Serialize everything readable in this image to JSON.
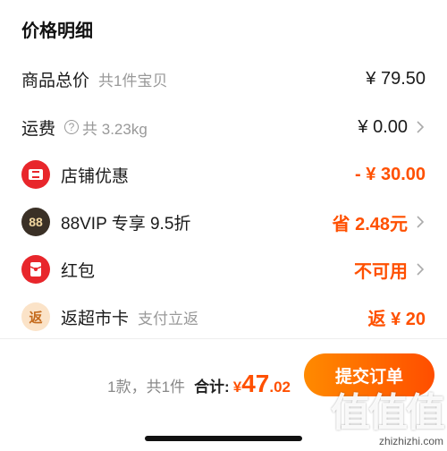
{
  "page": {
    "title": "价格明细"
  },
  "rows": [
    {
      "label": "商品总价",
      "sub": "共1件宝贝",
      "value": "¥ 79.50"
    },
    {
      "label": "运费",
      "sub": "共 3.23kg",
      "value": "¥ 0.00"
    },
    {
      "label": "店铺优惠",
      "value": "- ¥ 30.00"
    },
    {
      "label": "88VIP 专享 9.5折",
      "value": "省 2.48元",
      "icon_text": "88"
    },
    {
      "label": "红包",
      "value": "不可用"
    },
    {
      "label": "返超市卡",
      "sub": "支付立返",
      "value": "返 ¥ 20",
      "icon_text": "返"
    }
  ],
  "icons": {
    "help": "question-circle-icon",
    "shop_discount": "shop-coupon-icon",
    "vip": "88vip-badge-icon",
    "red_packet": "red-packet-icon",
    "supermarket": "supermarket-card-icon",
    "chevron": "chevron-right-icon"
  },
  "footer": {
    "count": "1款，共1件",
    "total_label": "合计:",
    "currency": "¥",
    "total_int": "47",
    "total_dec": ".02",
    "submit_label": "提交订单"
  },
  "watermark": {
    "logo": "值值值",
    "url": "zhizhizhi.com"
  },
  "colors": {
    "accent": "#ff5000",
    "red_icon": "#e8262b",
    "vip_dark": "#3a3026"
  }
}
